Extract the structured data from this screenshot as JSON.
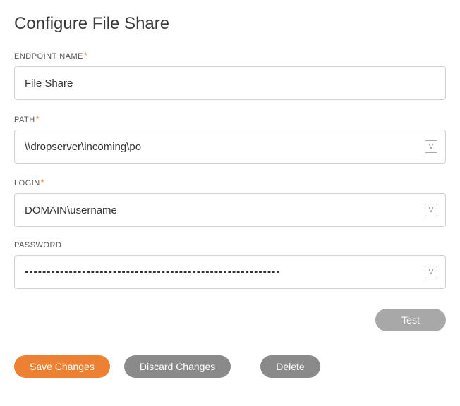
{
  "page": {
    "title": "Configure File Share"
  },
  "labels": {
    "endpoint_name": "ENDPOINT NAME",
    "path": "PATH",
    "login": "LOGIN",
    "password": "PASSWORD"
  },
  "required_marker": "*",
  "values": {
    "endpoint_name": "File Share",
    "path": "\\\\dropserver\\incoming\\po",
    "login": "DOMAIN\\username",
    "password": "••••••••••••••••••••••••••••••••••••••••••••••••••••••••••"
  },
  "buttons": {
    "test": "Test",
    "save": "Save Changes",
    "discard": "Discard Changes",
    "delete": "Delete"
  },
  "icons": {
    "v_badge": "V"
  }
}
